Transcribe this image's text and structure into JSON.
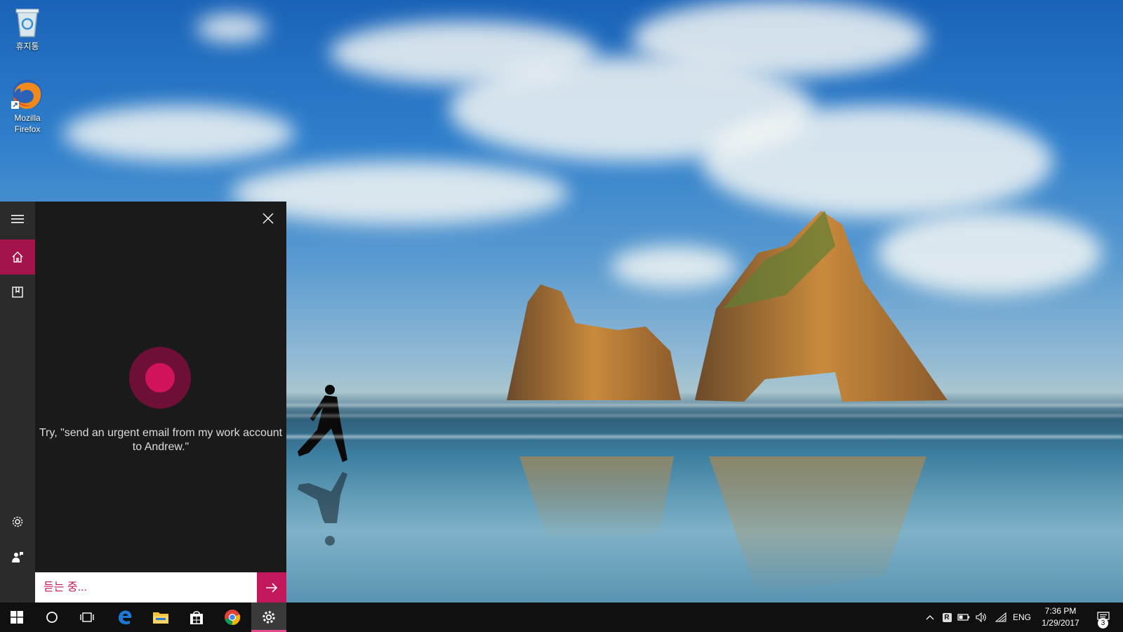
{
  "desktop": {
    "icons": [
      {
        "label": "휴지통",
        "icon": "recycle-bin-icon"
      },
      {
        "label": "Mozilla Firefox",
        "icon": "firefox-icon"
      }
    ]
  },
  "cortana": {
    "rail": {
      "menu_icon": "hamburger-icon",
      "home_icon": "home-icon",
      "notebook_icon": "notebook-icon",
      "settings_icon": "gear-icon",
      "feedback_icon": "feedback-icon"
    },
    "hint": "Try, \"send an urgent email from my work account to Andrew.\"",
    "input_placeholder": "듣는 중...",
    "submit_icon": "arrow-right-icon",
    "colors": {
      "accent": "#c2185b",
      "rail_active": "#a4134b",
      "panel_bg": "#1a1a1a",
      "ring": "#6d0f36",
      "dot": "#d0135a"
    }
  },
  "taskbar": {
    "apps": [
      {
        "name": "start",
        "icon": "windows-logo-icon"
      },
      {
        "name": "cortana",
        "icon": "cortana-circle-icon"
      },
      {
        "name": "task-view",
        "icon": "task-view-icon"
      },
      {
        "name": "edge",
        "icon": "edge-icon"
      },
      {
        "name": "file-explorer",
        "icon": "folder-icon"
      },
      {
        "name": "store",
        "icon": "store-icon"
      },
      {
        "name": "chrome",
        "icon": "chrome-icon"
      },
      {
        "name": "settings",
        "icon": "gear-icon"
      }
    ],
    "tray": {
      "chevron_icon": "chevron-up-icon",
      "ime_label": "R",
      "battery_icon": "battery-icon",
      "volume_icon": "volume-icon",
      "network_icon": "wifi-icon",
      "language": "ENG"
    },
    "clock": {
      "time": "7:36 PM",
      "date": "1/29/2017"
    },
    "notifications": {
      "icon": "action-center-icon",
      "count": "3"
    }
  }
}
